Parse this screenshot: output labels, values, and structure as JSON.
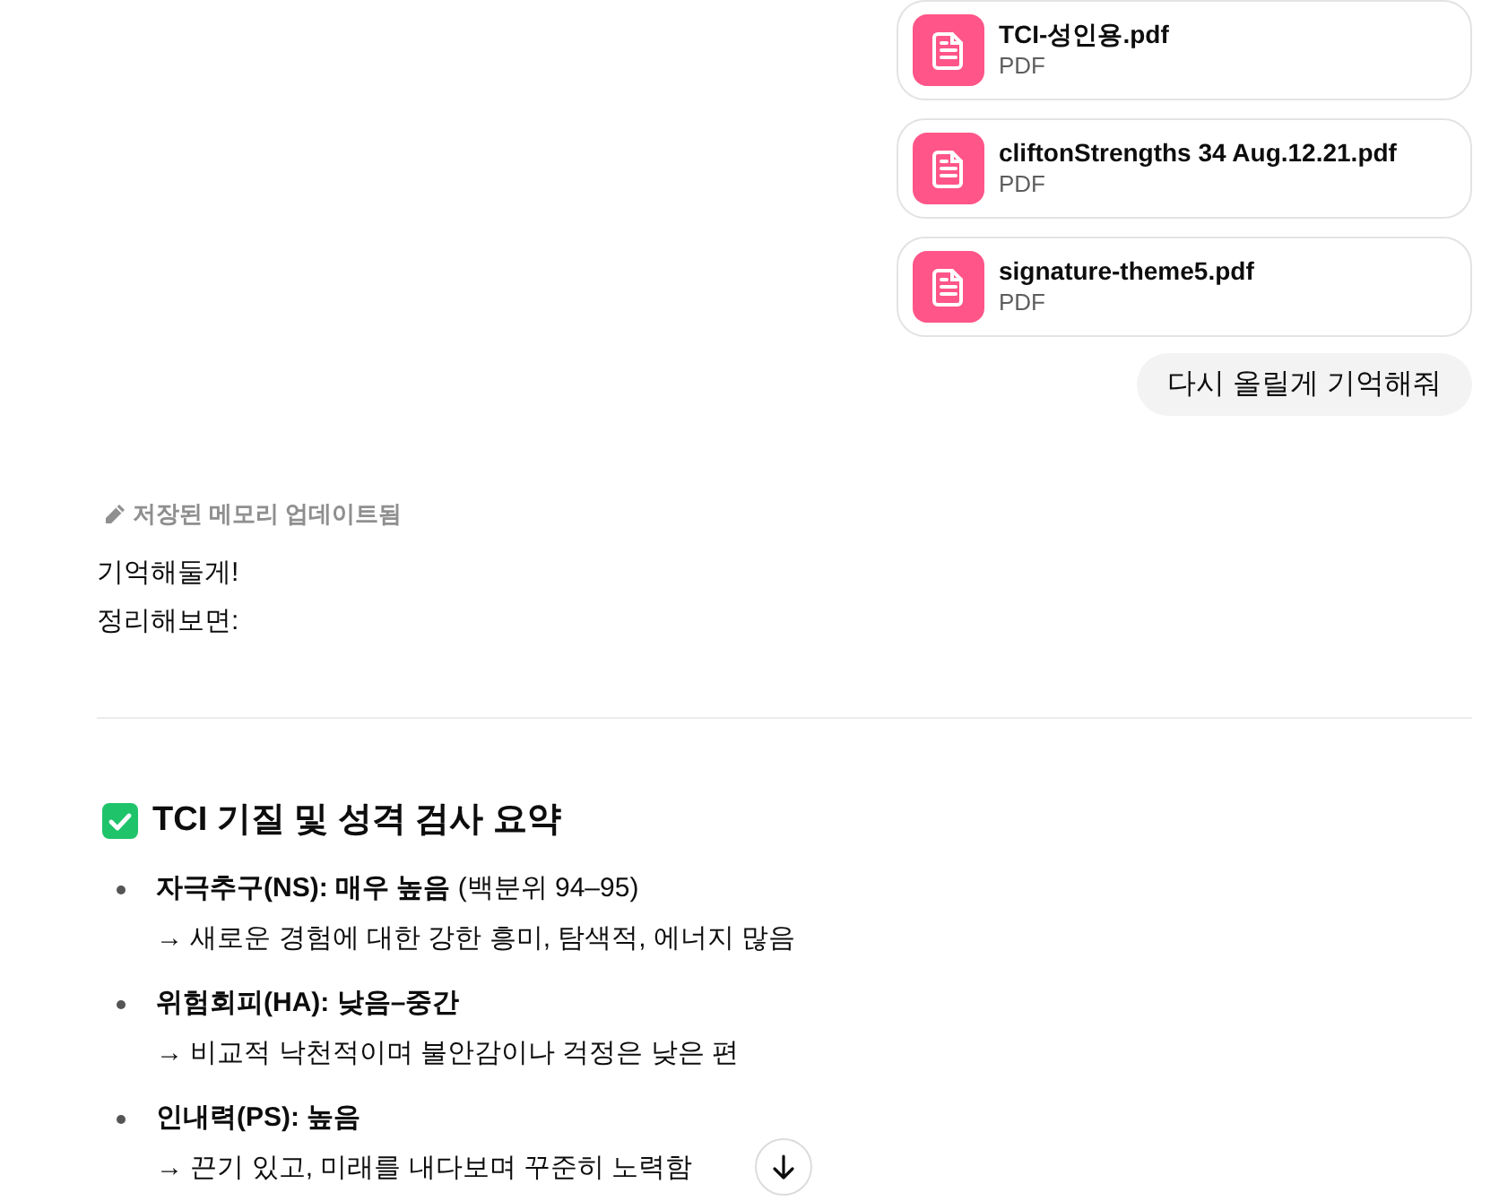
{
  "attachments": [
    {
      "name": "TCI-성인용.pdf",
      "type": "PDF"
    },
    {
      "name": "cliftonStrengths 34 Aug.12.21.pdf",
      "type": "PDF"
    },
    {
      "name": "signature-theme5.pdf",
      "type": "PDF"
    }
  ],
  "user_message": "다시 올릴게 기억해줘",
  "memory_notice": "저장된 메모리 업데이트됨",
  "reply": {
    "paragraphs": [
      "기억해둘게!",
      "정리해보면:"
    ],
    "section": {
      "title": "TCI 기질 및 성격 검사 요약",
      "items": [
        {
          "label": "자극추구(NS): 매우 높음",
          "note": "(백분위 94–95)",
          "detail": "→ 새로운 경험에 대한 강한 흥미, 탐색적, 에너지 많음"
        },
        {
          "label": "위험회피(HA): 낮음–중간",
          "detail": "→ 비교적 낙천적이며 불안감이나 걱정은 낮은 편"
        },
        {
          "label": "인내력(PS): 높음",
          "detail": "→ 끈기 있고, 미래를 내다보며 꾸준히 노력함"
        }
      ]
    }
  }
}
